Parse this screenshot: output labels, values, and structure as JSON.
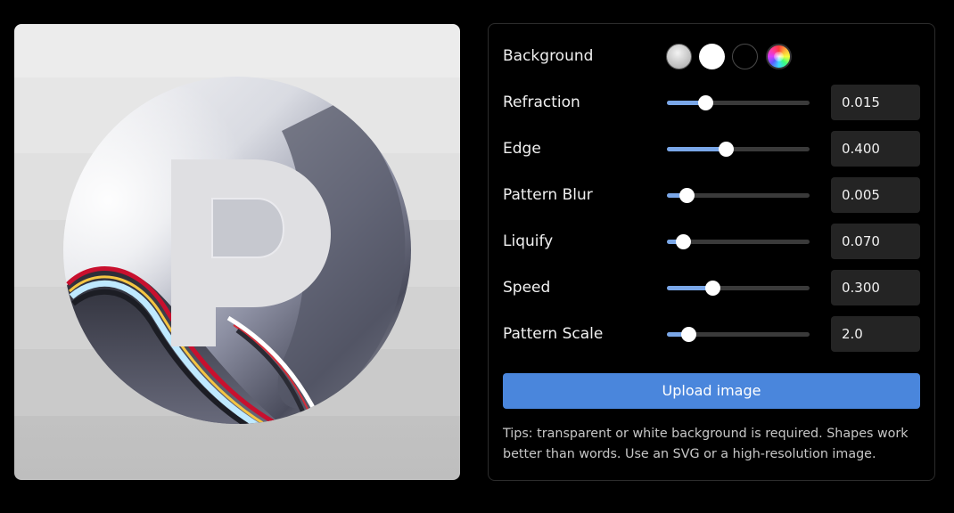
{
  "background": {
    "label": "Background",
    "swatches": [
      {
        "name": "metallic-gray",
        "color": "#bcbcbc"
      },
      {
        "name": "white",
        "color": "#ffffff"
      },
      {
        "name": "black",
        "color": "#000000"
      },
      {
        "name": "rainbow",
        "color": "multicolor"
      }
    ]
  },
  "controls": [
    {
      "label": "Refraction",
      "value": "0.015",
      "fraction": 0.27
    },
    {
      "label": "Edge",
      "value": "0.400",
      "fraction": 0.41
    },
    {
      "label": "Pattern Blur",
      "value": "0.005",
      "fraction": 0.14
    },
    {
      "label": "Liquify",
      "value": "0.070",
      "fraction": 0.11
    },
    {
      "label": "Speed",
      "value": "0.300",
      "fraction": 0.32
    },
    {
      "label": "Pattern Scale",
      "value": "2.0",
      "fraction": 0.15
    }
  ],
  "upload_label": "Upload image",
  "tips": "Tips: transparent or white background is required. Shapes work better than words. Use an SVG or a high-resolution image.",
  "colors": {
    "accent": "#4a86dc",
    "slider_fill": "#7aa7e8",
    "panel_border": "#2c2c2c",
    "input_bg": "#242424"
  }
}
